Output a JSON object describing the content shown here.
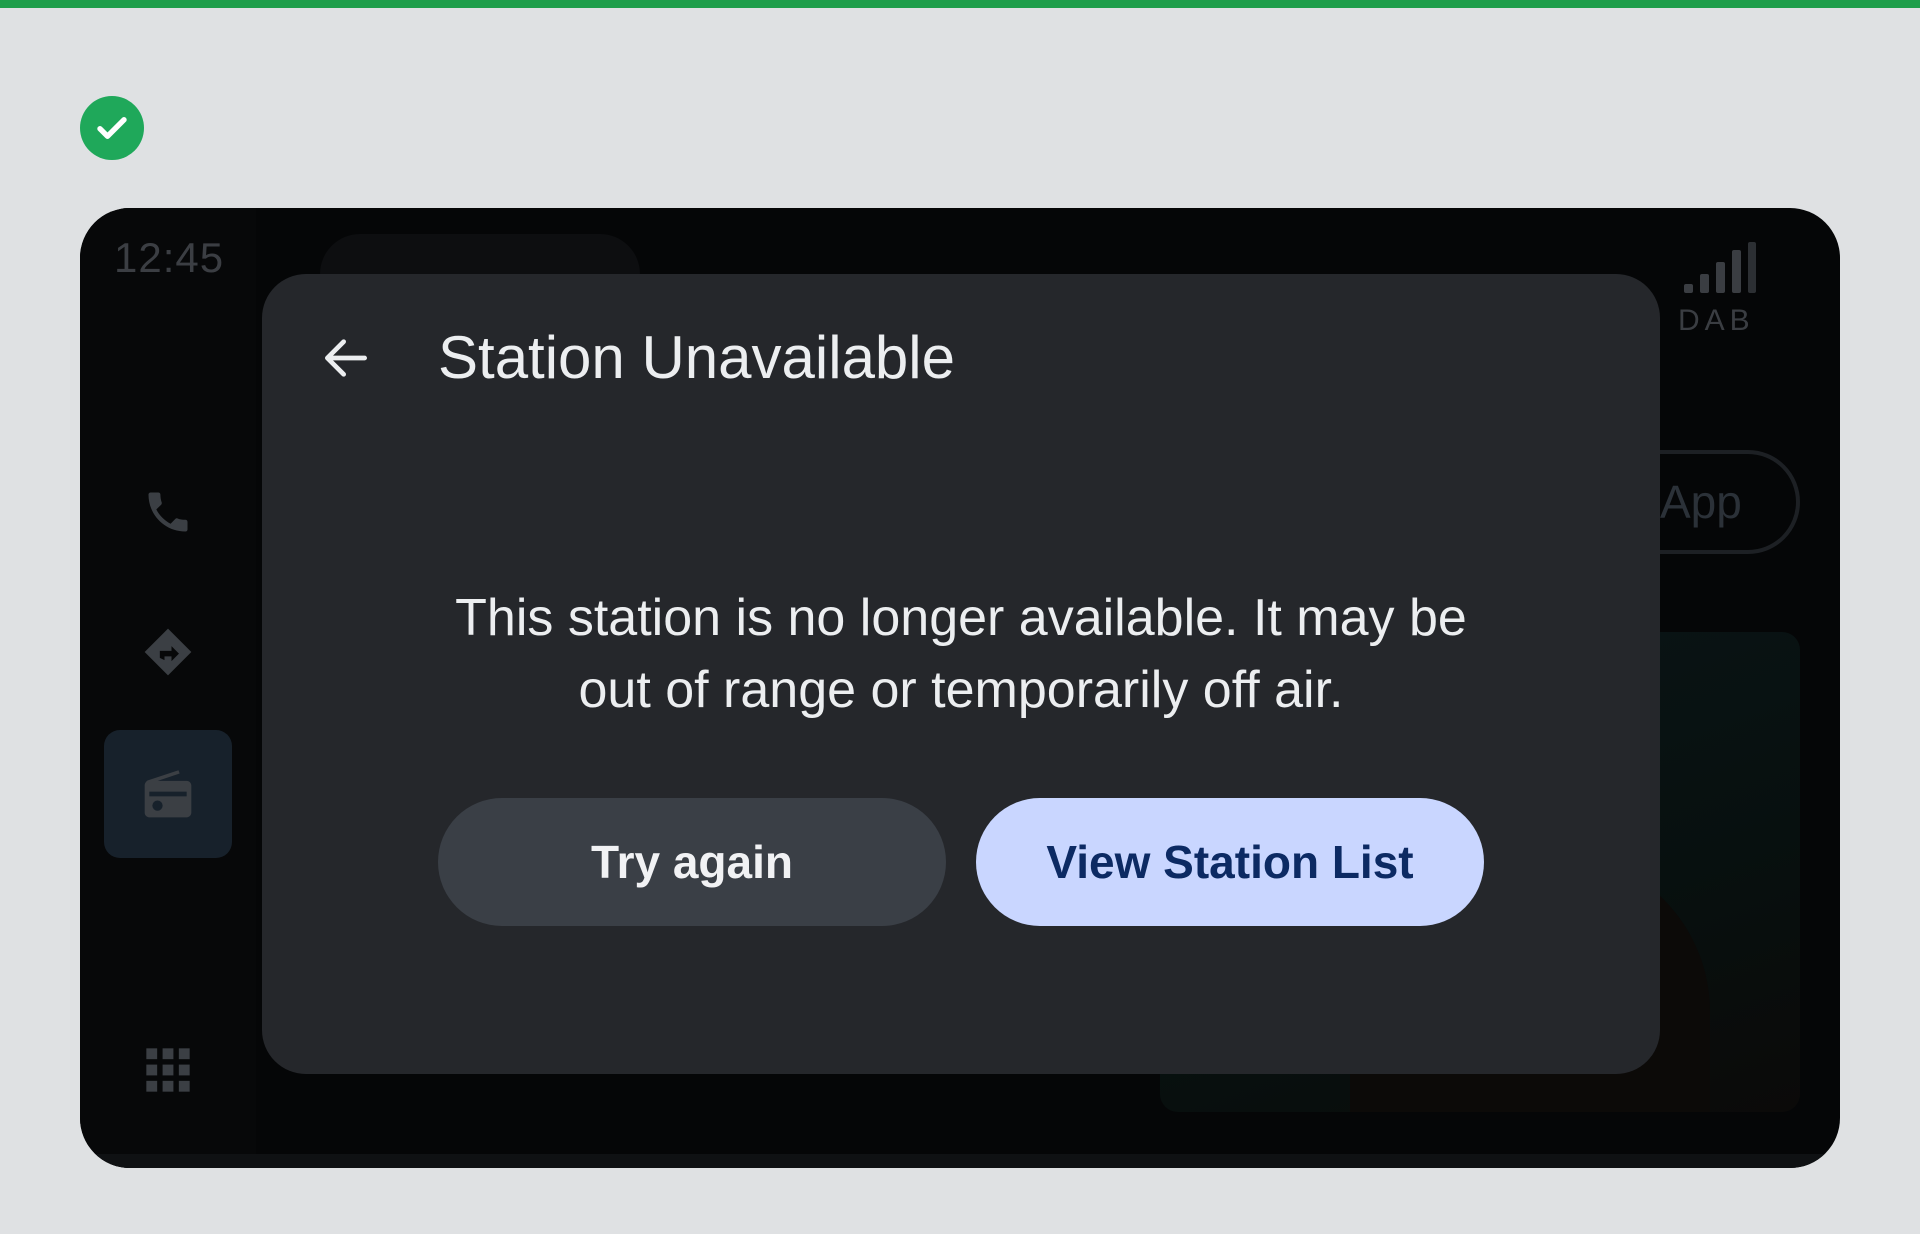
{
  "status": {
    "clock": "12:45",
    "network_label": "DAB"
  },
  "background_app": {
    "app_button_label": "App"
  },
  "dialog": {
    "title": "Station Unavailable",
    "message": "This station is no longer available. It may be out of range or temporarily off air.",
    "secondary_button": "Try again",
    "primary_button": "View Station List"
  },
  "rail": {
    "items": [
      {
        "icon": "phone-icon",
        "active": false
      },
      {
        "icon": "navigation-icon",
        "active": false
      },
      {
        "icon": "radio-icon",
        "active": true
      },
      {
        "icon": "app-grid-icon",
        "active": false
      }
    ]
  },
  "colors": {
    "accent_green": "#1e9e4a",
    "primary_button_bg": "#c9d6ff",
    "primary_button_text": "#0c2a63",
    "dialog_bg": "#25272b"
  }
}
